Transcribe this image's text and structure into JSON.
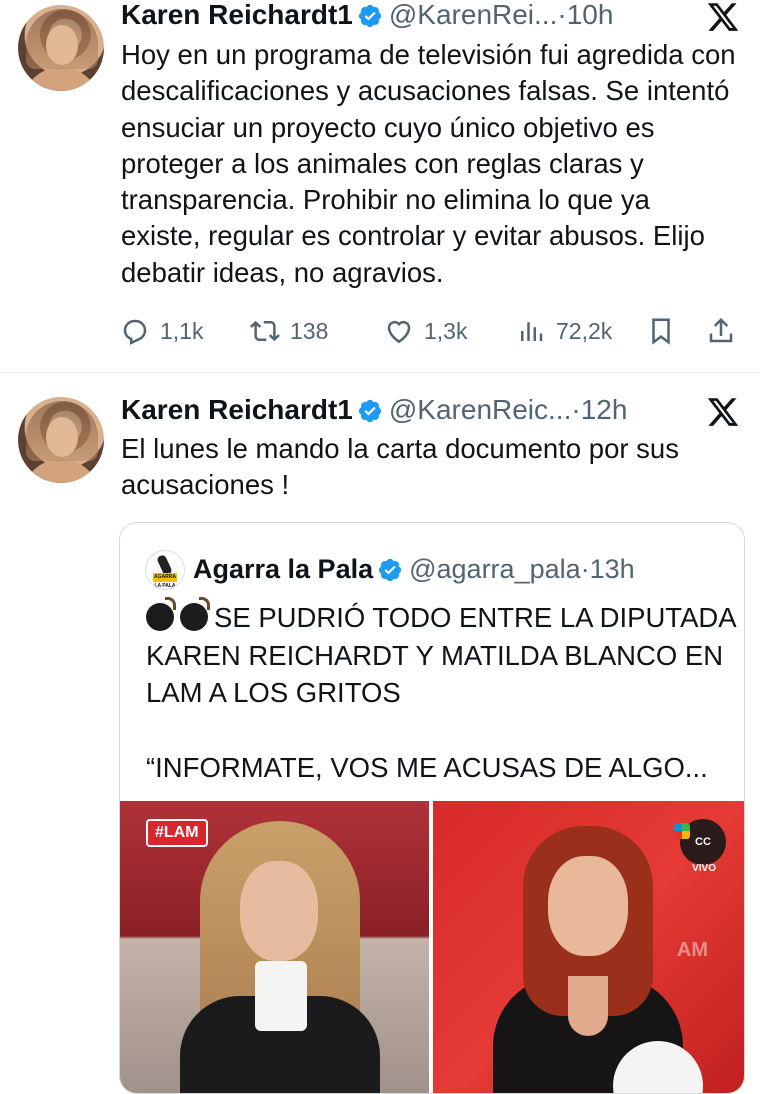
{
  "tweets": [
    {
      "name": "Karen Reichardt1",
      "handle": "@KarenRei...",
      "dot": "·",
      "time": "10h",
      "text": "Hoy en un programa de televisión fui agredida con descalificaciones y acusaciones falsas. Se intentó ensuciar un proyecto cuyo único objetivo es proteger a los animales con reglas claras y transparencia. Prohibir no elimina lo que ya existe, regular es controlar y evitar abusos. Elijo debatir ideas, no agravios.",
      "actions": {
        "replies": "1,1k",
        "reposts": "138",
        "likes": "1,3k",
        "views": "72,2k"
      }
    },
    {
      "name": "Karen Reichardt1",
      "handle": "@KarenReic...",
      "dot": "·",
      "time": "12h",
      "text": "El lunes le mando la carta documento por sus acusaciones !"
    }
  ],
  "quote": {
    "name": "Agarra la Pala",
    "handle": "@agarra_pala",
    "dot": "·",
    "time": "13h",
    "avatar_badge": "AGARRA LA PALA",
    "text": "SE PUDRIÓ TODO ENTRE LA DIPUTADA KAREN REICHARDT Y MATILDA BLANCO EN LAM A LOS GRITOS\n\n“INFORMATE, VOS ME ACUSAS DE ALGO...",
    "media": {
      "left_tag": "#LAM",
      "channel_logo": "CC",
      "live_label": "VIVO",
      "watermark": "AM"
    }
  },
  "colors": {
    "verified": "#1d9bf0",
    "secondary": "#536471",
    "border": "#cfd9de",
    "lam_red": "#d7262c"
  }
}
